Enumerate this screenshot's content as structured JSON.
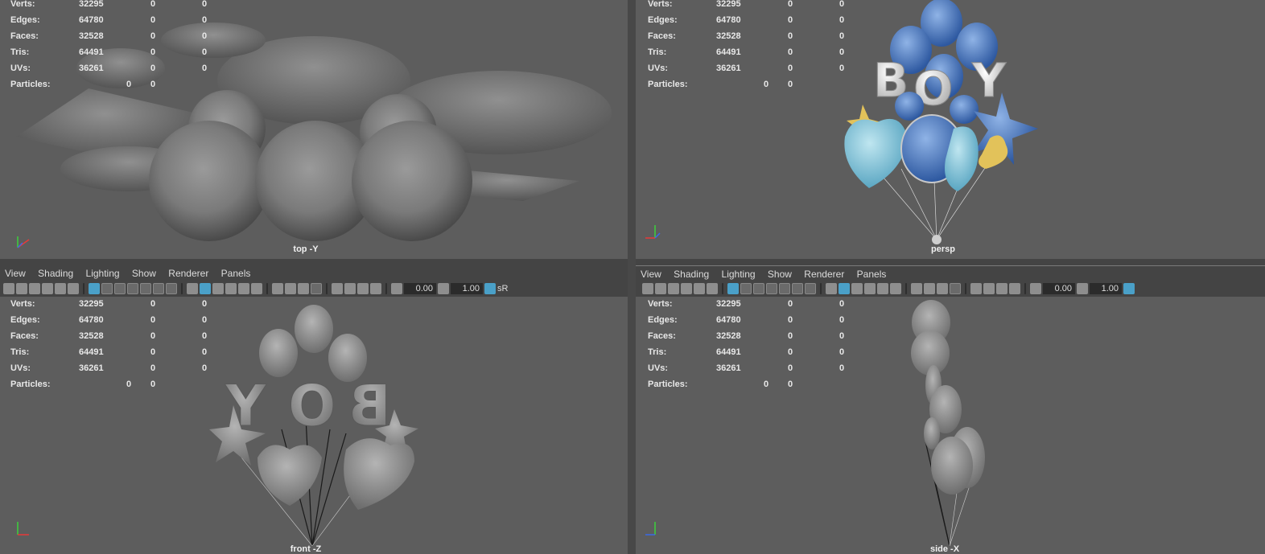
{
  "stats": [
    {
      "label": "Verts:",
      "v1": "32295",
      "v2": "0",
      "v3": "0"
    },
    {
      "label": "Edges:",
      "v1": "64780",
      "v2": "0",
      "v3": "0"
    },
    {
      "label": "Faces:",
      "v1": "32528",
      "v2": "0",
      "v3": "0"
    },
    {
      "label": "Tris:",
      "v1": "64491",
      "v2": "0",
      "v3": "0"
    },
    {
      "label": "UVs:",
      "v1": "36261",
      "v2": "0",
      "v3": "0"
    }
  ],
  "particles": {
    "label": "Particles:",
    "v1": "0",
    "v2": "0"
  },
  "menu": {
    "view": "View",
    "shading": "Shading",
    "lighting": "Lighting",
    "show": "Show",
    "renderer": "Renderer",
    "panels": "Panels"
  },
  "toolbar": {
    "exposure": "0.00",
    "gamma": "1.00",
    "colorspace": "sR"
  },
  "viewports": {
    "top": {
      "camera": "top -Y"
    },
    "persp": {
      "camera": "persp"
    },
    "front": {
      "camera": "front -Z"
    },
    "side": {
      "camera": "side -X"
    }
  },
  "colors": {
    "viewport_bg": "#5d5d5d",
    "panel_bg": "#444444",
    "accent": "#4aa0c8",
    "balloon_blue": "#3f6fb8",
    "balloon_light": "#7fc6dc",
    "gold": "#e2c25a"
  },
  "icons": [
    "camera-icon",
    "grid-icon",
    "wireframe-icon",
    "shaded-icon",
    "textured-icon",
    "light-icon",
    "isolate-icon",
    "exposure-icon",
    "gamma-icon",
    "color-management-icon"
  ]
}
